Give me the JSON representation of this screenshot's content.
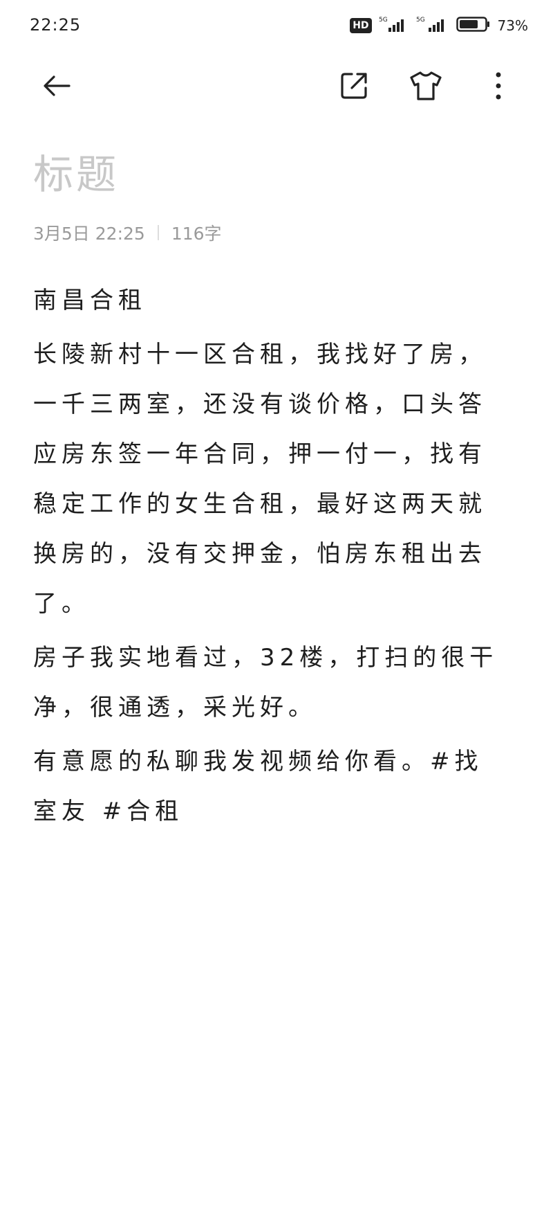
{
  "status_bar": {
    "time": "22:25",
    "hd_badge": "HD",
    "network_1": "5G",
    "network_2": "5G",
    "battery_percent": "73%",
    "battery_level": 0.73
  },
  "toolbar": {
    "back_icon": "arrow-left-icon",
    "share_icon": "share-external-icon",
    "theme_icon": "tshirt-icon",
    "more_icon": "more-vertical-icon"
  },
  "note": {
    "title_placeholder": "标题",
    "date": "3月5日 22:25",
    "word_count": "116字",
    "paragraphs": [
      "南昌合租",
      "长陵新村十一区合租，我找好了房，一千三两室，还没有谈价格，口头答应房东签一年合同，押一付一，找有稳定工作的女生合租，最好这两天就换房的，没有交押金，怕房东租出去了。",
      "房子我实地看过，32楼，打扫的很干净，很通透，采光好。",
      "有意愿的私聊我发视频给你看。#找室友 #合租"
    ]
  }
}
